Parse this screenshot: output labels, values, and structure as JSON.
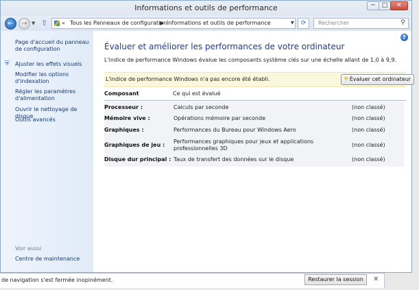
{
  "window": {
    "title": "Informations et outils de performance",
    "min_glyph": "─",
    "max_glyph": "□",
    "close_glyph": "✕"
  },
  "nav": {
    "back_glyph": "←",
    "forward_glyph": "→",
    "recent_glyph": "▼",
    "up_glyph": "⇧",
    "breadcrumb_chevrons": "«",
    "breadcrumb": [
      "Tous les Panneaux de configuration",
      "Informations et outils de performance"
    ],
    "crumb_separator": "▶",
    "dropdown_glyph": "▼",
    "refresh_glyph": "⟳",
    "search_placeholder": "Rechercher",
    "search_glyph": "⚲"
  },
  "sidebar": {
    "items": [
      {
        "label": "Page d'accueil du panneau de configuration",
        "icon": null
      },
      {
        "label": "Ajuster les effets visuels",
        "icon": "shield-icon"
      },
      {
        "label": "Modifier les options d'indexation",
        "icon": null
      },
      {
        "label": "Régler les paramètres d'alimentation",
        "icon": null
      },
      {
        "label": "Ouvrir le nettoyage de disque",
        "icon": null
      },
      {
        "label": "Outils avancés",
        "icon": null
      }
    ],
    "see_also": "Voir aussi",
    "see_also_items": [
      "Centre de maintenance"
    ]
  },
  "main": {
    "help_glyph": "?",
    "heading": "Évaluer et améliorer les performances de votre ordinateur",
    "intro": "L'indice de performance Windows évalue les composants système clés sur une échelle allant de 1,0 à 9,9.",
    "notice": "L'indice de performance Windows n'a pas encore été établi.",
    "eval_button": "Évaluer cet ordinateur",
    "table": {
      "headers": [
        "Composant",
        "Ce qui est évalué"
      ],
      "rows": [
        {
          "name": "Processeur :",
          "desc": "Calculs par seconde",
          "status": "(non classé)"
        },
        {
          "name": "Mémoire vive :",
          "desc": "Opérations mémoire par seconde",
          "status": "(non classé)"
        },
        {
          "name": "Graphiques :",
          "desc": "Performances du Bureau pour Windows Aero",
          "status": "(non classé)"
        },
        {
          "name": "Graphiques de jeu :",
          "desc": "Performances graphiques pour jeux et applications professionnelles 3D",
          "status": "(non classé)"
        },
        {
          "name": "Disque dur principal :",
          "desc": "Taux de transfert des données sur le disque",
          "status": "(non classé)"
        }
      ]
    }
  },
  "notification": {
    "message": "de navigation s'est fermée inopinément.",
    "restore_label": "Restaurer la session",
    "close_glyph": "✕"
  },
  "colors": {
    "link": "#14387a",
    "heading": "#1e3b8a",
    "notice_bg": "#fbf7dd"
  }
}
